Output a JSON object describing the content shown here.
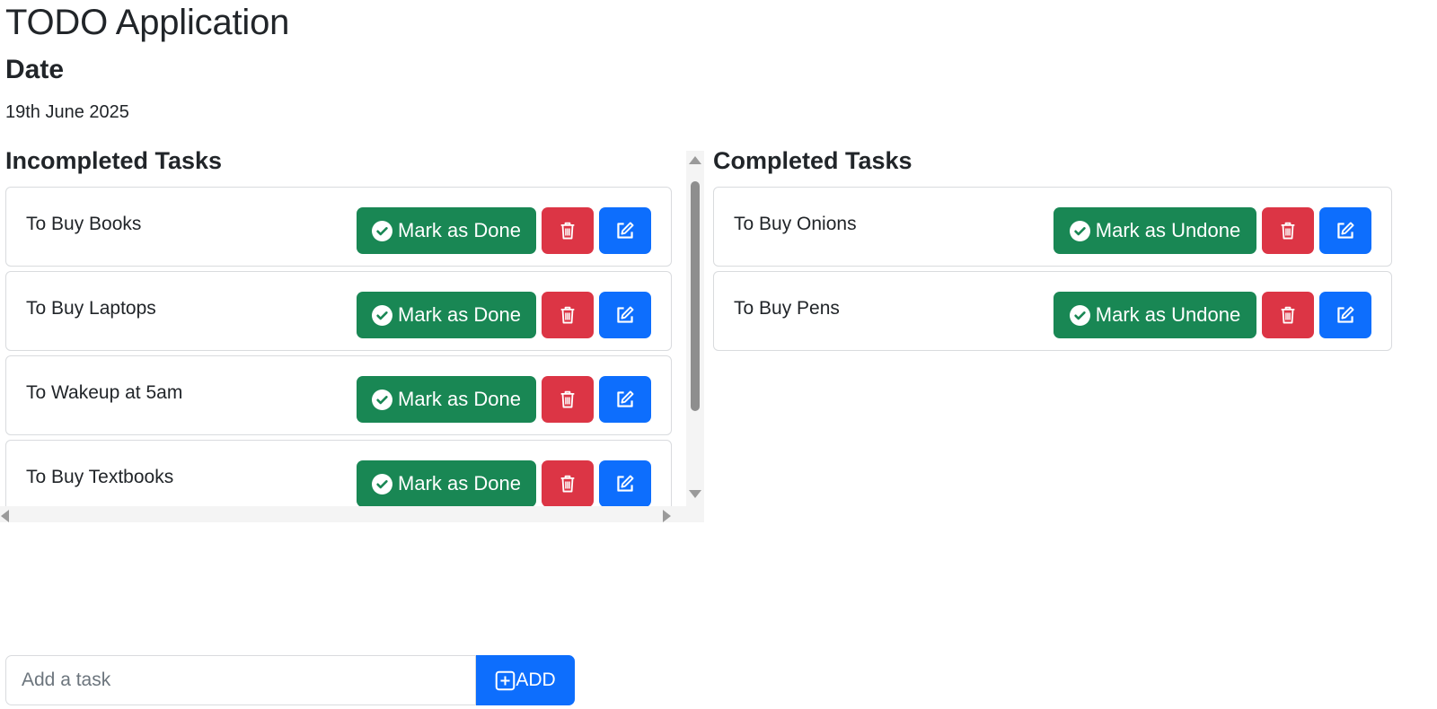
{
  "app": {
    "title": "TODO Application"
  },
  "date": {
    "heading": "Date",
    "value": "19th June 2025"
  },
  "incomplete": {
    "title": "Incompleted Tasks",
    "tasks": [
      {
        "text": "To Buy Books",
        "action_label": "Mark as Done"
      },
      {
        "text": "To Buy Laptops",
        "action_label": "Mark as Done"
      },
      {
        "text": "To Wakeup at 5am",
        "action_label": "Mark as Done"
      },
      {
        "text": "To Buy Textbooks",
        "action_label": "Mark as Done"
      }
    ]
  },
  "completed": {
    "title": "Completed Tasks",
    "tasks": [
      {
        "text": "To Buy Onions",
        "action_label": "Mark as Undone"
      },
      {
        "text": "To Buy Pens",
        "action_label": "Mark as Undone"
      }
    ]
  },
  "add": {
    "placeholder": "Add a task",
    "button_label": "ADD"
  },
  "icons": {
    "done": "check-circle-icon",
    "delete": "trash-icon",
    "edit": "edit-icon",
    "add": "plus-square-icon"
  },
  "colors": {
    "success": "#198754",
    "danger": "#dc3545",
    "primary": "#0d6efd"
  }
}
